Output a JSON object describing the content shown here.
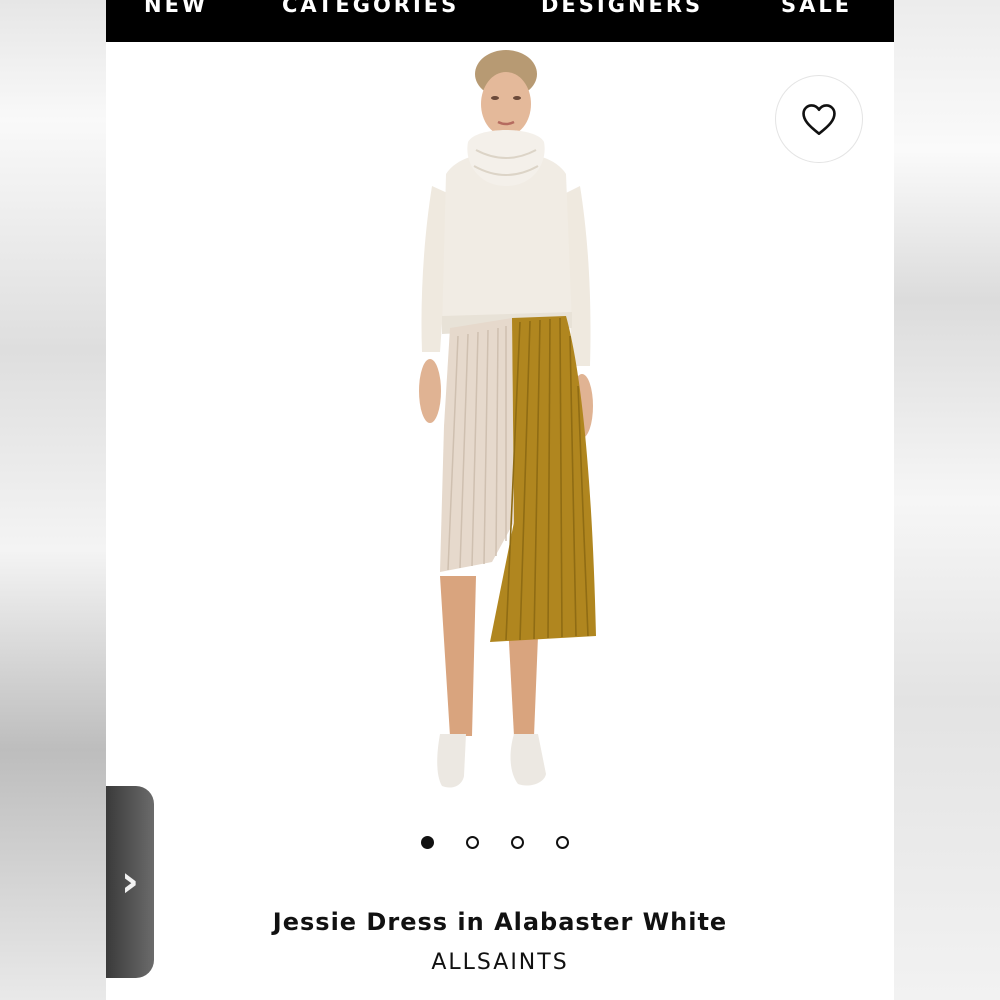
{
  "nav": {
    "items": [
      "NEW",
      "CATEGORIES",
      "DESIGNERS",
      "SALE"
    ]
  },
  "product": {
    "name": "Jessie Dress in Alabaster White",
    "brand": "ALLSAINTS",
    "image_count": 4,
    "active_image": 1
  },
  "side_tab": {
    "glyph": "›"
  },
  "icons": {
    "favorite": "heart-outline-icon",
    "side_tab": "chevron-right-icon"
  },
  "colors": {
    "nav_bg": "#000000",
    "nav_text": "#ffffff",
    "text": "#111111",
    "sweater": "#f1ece4",
    "skirt_cream": "#e6d9cc",
    "skirt_mustard": "#b0861f"
  }
}
